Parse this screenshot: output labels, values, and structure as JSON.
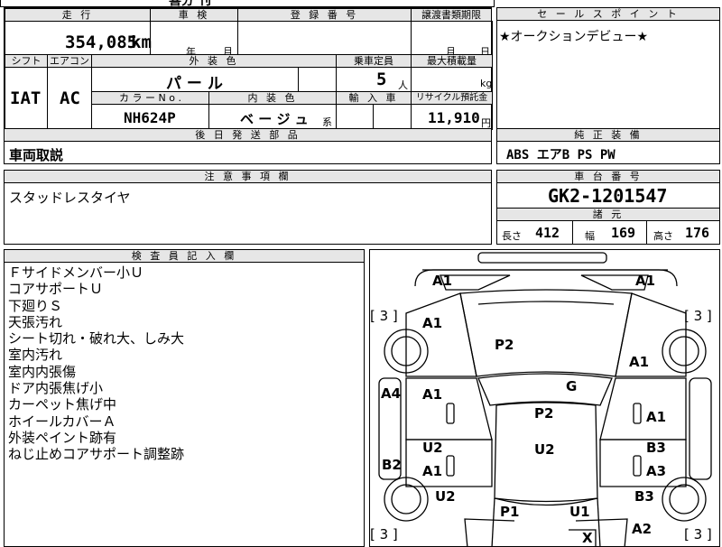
{
  "top_bar": {
    "partial": "喜分 刊"
  },
  "header": {
    "mileage_label": "走 行",
    "shaken_label": "車 検",
    "reg_label": "登 録 番 号",
    "transfer_label": "譲渡書類期限",
    "mileage_value": "354,085",
    "mileage_unit": "km",
    "year_unit": "年",
    "month_unit": "月",
    "transfer_month": "月",
    "transfer_day": "日",
    "shift_label": "シフト",
    "ac_label": "エアコン",
    "exterior_label": "外 装 色",
    "capacity_label": "乗車定員",
    "maxload_label": "最大積載量",
    "shift_value": "IAT",
    "ac_value": "AC",
    "exterior_value": "パ ー ル",
    "capacity_value": "5",
    "capacity_unit": "人",
    "load_unit": "kg",
    "color_no_label": "カ ラ ー  N o .",
    "interior_label": "内 装 色",
    "import_label": "輸 入 車",
    "recycle_label": "リサイクル預託金",
    "color_no_value": "NH624P",
    "interior_value": "ベ ー ジ ュ",
    "interior_suffix": "系",
    "recycle_value": "11,910",
    "recycle_unit": "円"
  },
  "later_parts": {
    "label": "後 日 発 送 部 品",
    "value": "車両取説"
  },
  "caution": {
    "label": "注 意 事 項 欄",
    "value": "スタッドレスタイヤ"
  },
  "sales_point": {
    "label": "セ ー ル ス ポ イ ン ト",
    "value": "★オークションデビュー★"
  },
  "standard_equipment": {
    "label": "純 正 装 備",
    "value": "ABS エアB PS PW"
  },
  "chassis": {
    "label": "車 台 番 号",
    "value": "GK2-1201547"
  },
  "dimensions": {
    "label": "諸 元",
    "length_label": "長さ",
    "length_value": "412",
    "width_label": "幅",
    "width_value": "169",
    "height_label": "高さ",
    "height_value": "176"
  },
  "inspector": {
    "label": "検 査 員 記 入 欄",
    "notes": [
      "Ｆサイドメンバー小Ｕ",
      "コアサポートＵ",
      "下廻りＳ",
      "天張汚れ",
      "シート切れ・破れ大、しみ大",
      "室内汚れ",
      "室内内張傷",
      "ドア内張焦げ小",
      "カーペット焦げ中",
      "ホイールカバーＡ",
      "外装ペイント跡有",
      "ねじ止めコアサポート調整跡"
    ]
  },
  "diagram": {
    "labels": {
      "front_left": "A1",
      "front_right": "A1",
      "tread_fl": "[ 3 ]",
      "tread_fr": "[ 3 ]",
      "fender_left": "A1",
      "hood": "P2",
      "fender_right": "A1",
      "windshield": "G",
      "left_side": "A4",
      "front_door_left": "A1",
      "roof": "P2",
      "front_door_right": "A1",
      "rear_door_left_u": "U2",
      "rear_door_left_a": "A1",
      "rear_seat": "U2",
      "rear_door_right_b": "B3",
      "rear_door_right_a": "A3",
      "left_sill": "B2",
      "rear_fender_left": "U2",
      "rear_fender_right": "B3",
      "rear_left": "P1",
      "rear_right": "U1",
      "rear_bottom": "X",
      "tread_rl": "[ 3 ]",
      "tread_rr": "[ 3 ]",
      "rear_corner_right": "A2"
    }
  }
}
